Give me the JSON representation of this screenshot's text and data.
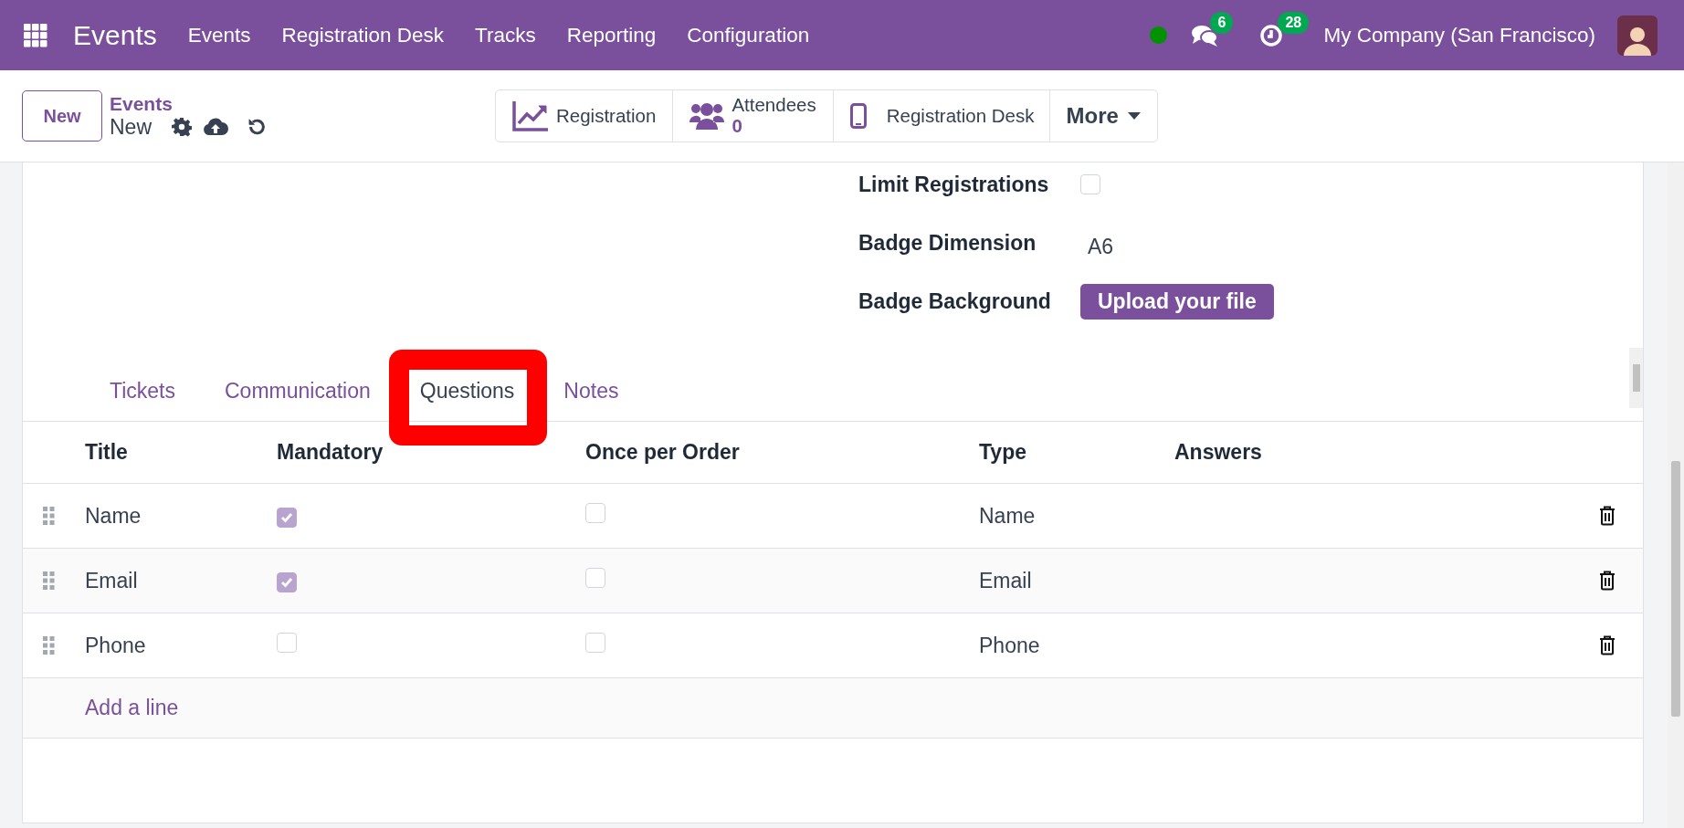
{
  "navbar": {
    "app_name": "Events",
    "menu": [
      "Events",
      "Registration Desk",
      "Tracks",
      "Reporting",
      "Configuration"
    ],
    "presence_online": true,
    "messages_count": "6",
    "activities_count": "28",
    "company": "My Company (San Francisco)"
  },
  "control_panel": {
    "new_button": "New",
    "breadcrumb": {
      "parent": "Events",
      "current": "New"
    },
    "stat_buttons": [
      {
        "kind": "chart",
        "label": "Registration"
      },
      {
        "kind": "people",
        "label": "Attendees",
        "value": "0"
      },
      {
        "kind": "phone",
        "label": "Registration Desk"
      },
      {
        "kind": "more",
        "label": "More"
      }
    ]
  },
  "form": {
    "fields": [
      {
        "kind": "checkbox",
        "label": "Limit Registrations",
        "checked": false
      },
      {
        "kind": "text",
        "label": "Badge Dimension",
        "value": "A6"
      },
      {
        "kind": "upload",
        "label": "Badge Background",
        "button": "Upload your file"
      }
    ],
    "tabs": [
      {
        "label": "Tickets",
        "selected": false,
        "annotated": false
      },
      {
        "label": "Communication",
        "selected": false,
        "annotated": false
      },
      {
        "label": "Questions",
        "selected": true,
        "annotated": true
      },
      {
        "label": "Notes",
        "selected": false,
        "annotated": false
      }
    ],
    "questions": {
      "columns": [
        "Title",
        "Mandatory",
        "Once per Order",
        "Type",
        "Answers"
      ],
      "rows": [
        {
          "title": "Name",
          "mandatory": true,
          "once_per_order": false,
          "type": "Name"
        },
        {
          "title": "Email",
          "mandatory": true,
          "once_per_order": false,
          "type": "Email"
        },
        {
          "title": "Phone",
          "mandatory": false,
          "once_per_order": false,
          "type": "Phone"
        }
      ],
      "add_line": "Add a line"
    }
  }
}
